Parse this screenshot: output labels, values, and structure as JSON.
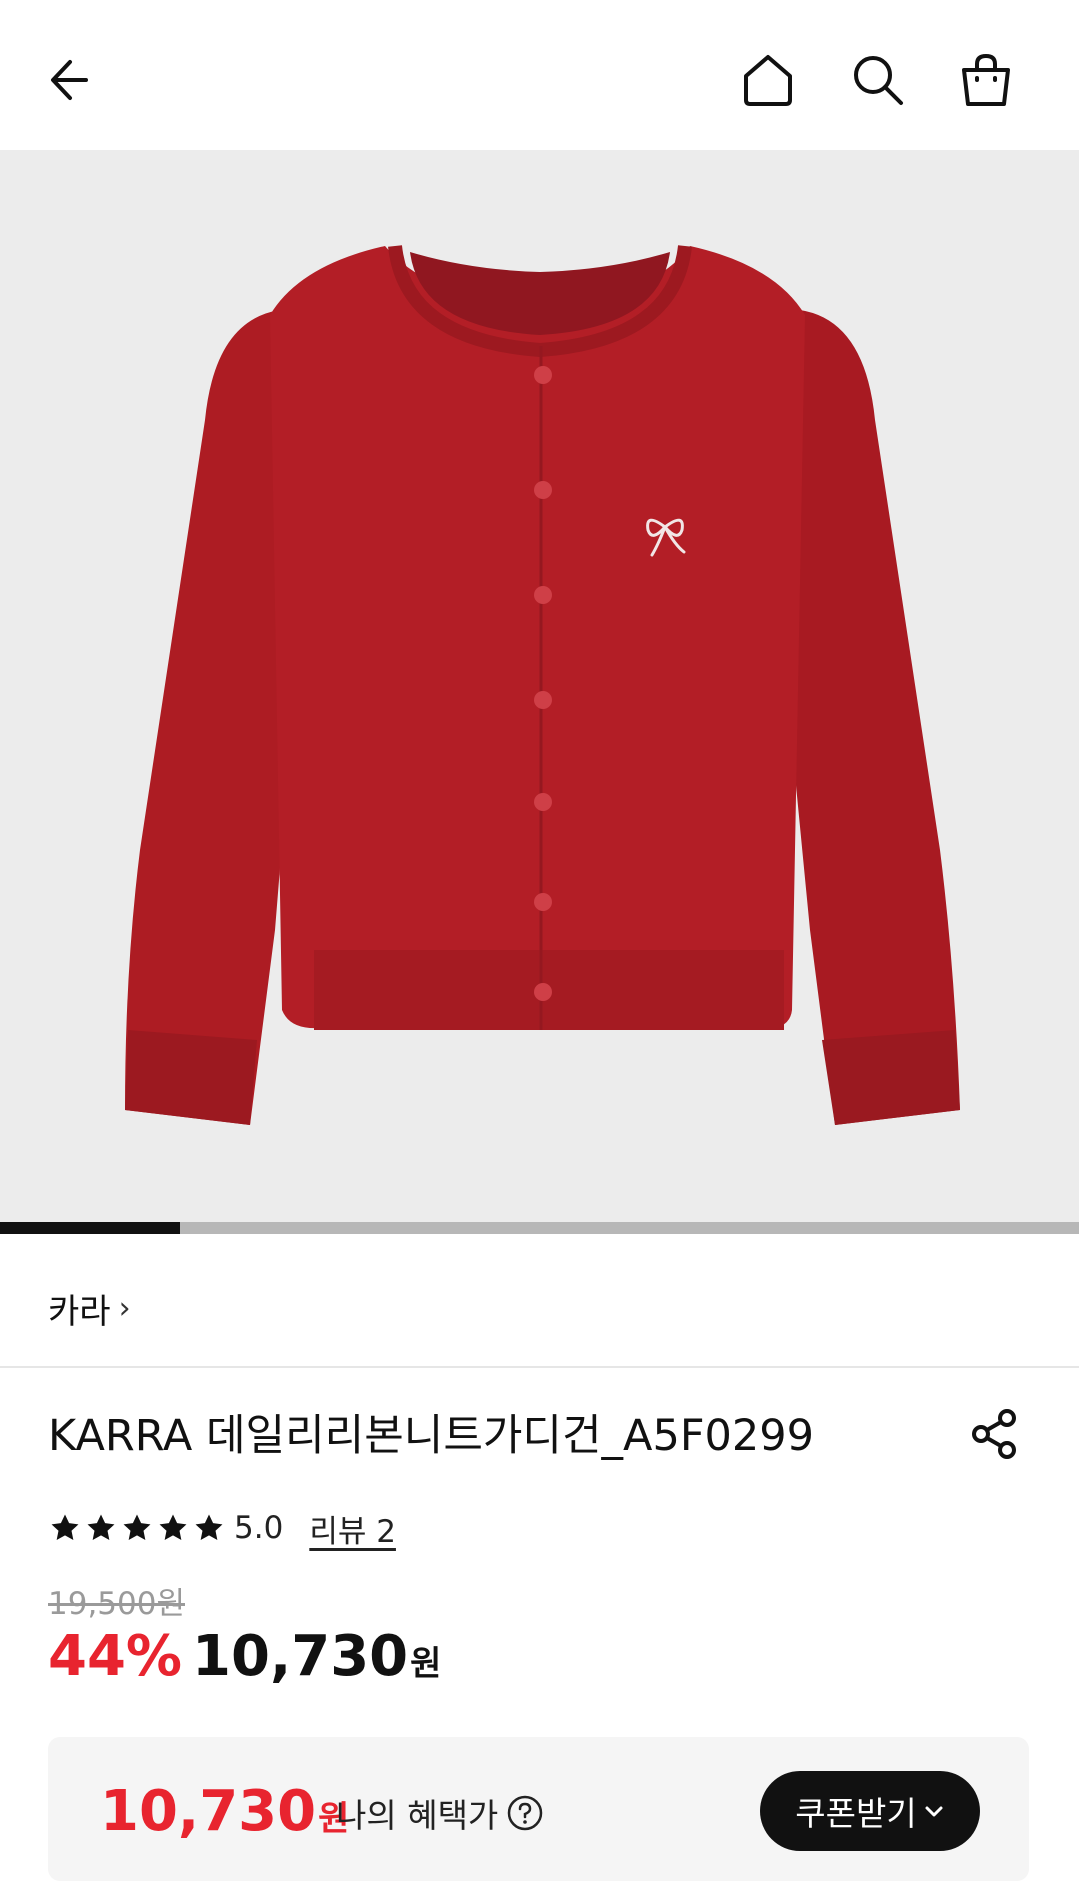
{
  "header": {
    "back_icon": "arrow-left-icon",
    "home_icon": "home-icon",
    "search_icon": "search-icon",
    "cart_icon": "shopping-bag-icon"
  },
  "gallery": {
    "image_subject": "red knit cardigan with bow embroidery",
    "progress": 0.167
  },
  "brand": {
    "name": "카라",
    "chevron": "›"
  },
  "product": {
    "title": "KARRA 데일리리본니트가디건_A5F0299",
    "share_icon": "share-icon",
    "rating": "5.0",
    "stars": 5,
    "review_link": "리뷰 2",
    "original_price": "19,500원",
    "discount": "44%",
    "sale_price": "10,730",
    "currency": "원"
  },
  "benefit": {
    "price": "10,730",
    "currency": "원",
    "label": "나의 혜택가",
    "help_icon": "question-circle-icon",
    "coupon_button": "쿠폰받기"
  },
  "colors": {
    "accent_red": "#e8242f",
    "dark": "#111111",
    "benefit_bg": "#f5f5f5"
  }
}
